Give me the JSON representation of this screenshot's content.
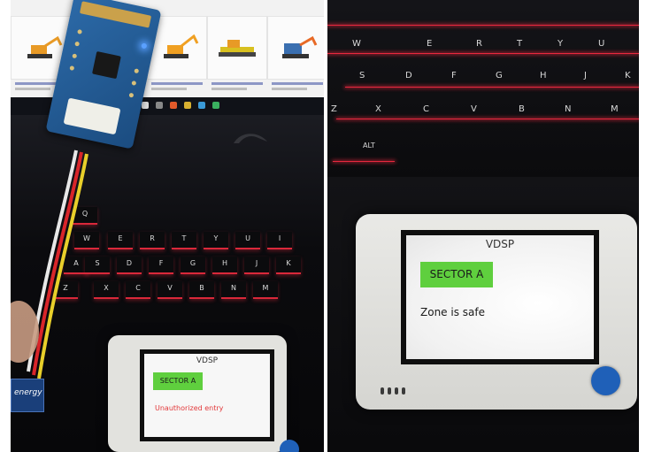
{
  "left_photo": {
    "device_screen": {
      "title": "VDSP",
      "sector_label": "SECTOR A",
      "status_message": "Unauthorized entry",
      "status_color": "#e2383a"
    },
    "keyboard_keys": [
      "Q",
      "W",
      "E",
      "R",
      "T",
      "Y",
      "U",
      "I",
      "A",
      "S",
      "D",
      "F",
      "G",
      "H",
      "J",
      "K",
      "Z",
      "X",
      "C",
      "V",
      "B",
      "N",
      "M"
    ],
    "sticker_text": "energy"
  },
  "right_photo": {
    "device_screen": {
      "title": "VDSP",
      "sector_label": "SECTOR A",
      "status_message": "Zone is safe",
      "status_color": "#1a1a1a"
    },
    "keyboard_keys": [
      "W",
      "E",
      "R",
      "T",
      "Y",
      "U",
      "S",
      "D",
      "F",
      "G",
      "H",
      "J",
      "K",
      "Z",
      "X",
      "C",
      "V",
      "B",
      "N",
      "M",
      "ALT"
    ]
  },
  "colors": {
    "sector_badge": "#5fcf3e",
    "device_button": "#1f60b8",
    "keyboard_backlight": "#d9283a"
  }
}
